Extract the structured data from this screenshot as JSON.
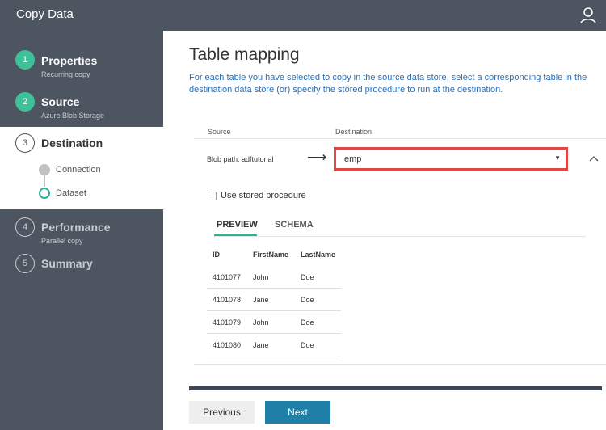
{
  "app": {
    "title": "Copy Data"
  },
  "steps": [
    {
      "number": "1",
      "label": "Properties",
      "sub": "Recurring copy"
    },
    {
      "number": "2",
      "label": "Source",
      "sub": "Azure Blob Storage"
    },
    {
      "number": "3",
      "label": "Destination",
      "sub": ""
    },
    {
      "number": "4",
      "label": "Performance",
      "sub": "Parallel copy"
    },
    {
      "number": "5",
      "label": "Summary",
      "sub": ""
    }
  ],
  "substeps": [
    {
      "label": "Connection"
    },
    {
      "label": "Dataset"
    }
  ],
  "main": {
    "title": "Table mapping",
    "description": "For each table you have selected to copy in the source data store, select a corresponding table in the destination data store (or) specify the stored procedure to run at the destination."
  },
  "mapping": {
    "source_header": "Source",
    "destination_header": "Destination",
    "source_value": "Blob path: adftutorial",
    "arrow": "⟶",
    "destination_value": "emp",
    "stored_procedure_label": "Use stored procedure"
  },
  "tabs": [
    {
      "label": "PREVIEW"
    },
    {
      "label": "SCHEMA"
    }
  ],
  "preview": {
    "columns": [
      "ID",
      "FirstName",
      "LastName"
    ],
    "rows": [
      [
        "4101077",
        "John",
        "Doe"
      ],
      [
        "4101078",
        "Jane",
        "Doe"
      ],
      [
        "4101079",
        "John",
        "Doe"
      ],
      [
        "4101080",
        "Jane",
        "Doe"
      ]
    ]
  },
  "footer": {
    "previous_label": "Previous",
    "next_label": "Next"
  },
  "colors": {
    "sidebar": "#4d5561",
    "accent_green": "#3cc199",
    "next_button": "#1f7fa6",
    "highlight_red": "#e04848"
  }
}
